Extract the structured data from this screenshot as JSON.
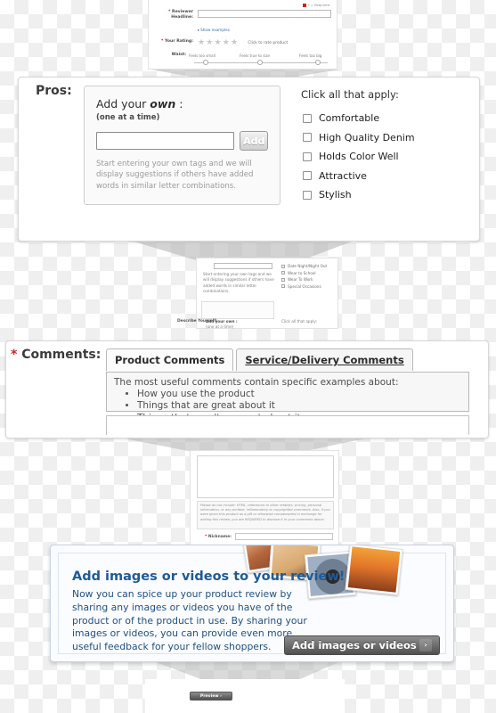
{
  "background": {
    "pattern": "transparency-checkerboard",
    "light": "#ffffff",
    "dark": "#efefef"
  },
  "top_form": {
    "required_note": "* = Required",
    "rows": [
      {
        "label": "Reviewer Headline:",
        "required": true,
        "link": "Show examples",
        "input_value": ""
      },
      {
        "label": "Your Rating:",
        "required": true,
        "stars": "★★★★★",
        "hint": "Click to rate product"
      },
      {
        "label": "Waist:",
        "required": false,
        "slider_captions": [
          "Feels too small",
          "Feels true to size",
          "Feels too big"
        ]
      }
    ]
  },
  "pros_section": {
    "label": "Pros:",
    "own_title_prefix": "Add your ",
    "own_title_emphasis": "own",
    "own_title_suffix": " :",
    "own_subtitle": "(one at a time)",
    "input_value": "",
    "add_button": "Add",
    "hint": "Start entering your own tags and we will display suggestions if others have added words in similar letter combinations.",
    "apply_heading": "Click all that apply:",
    "checkboxes": [
      {
        "label": "Comfortable",
        "checked": false
      },
      {
        "label": "High Quality Denim",
        "checked": false
      },
      {
        "label": "Holds Color Well",
        "checked": false
      },
      {
        "label": "Attractive",
        "checked": false
      },
      {
        "label": "Stylish",
        "checked": false
      }
    ]
  },
  "mid_mini_form": {
    "hint": "Start entering your own tags and we will display suggestions if others have added words in similar letter combinations.",
    "apply_heading": "Click all that apply:",
    "checkboxes": [
      "Date Night/Night Out",
      "Wear to School",
      "Wear To Work",
      "Special Occasions"
    ],
    "describe_label": "Describe Yourself:",
    "own_title": "Add your own :",
    "own_sub": "(one at a time)",
    "apply_heading2": "Click all that apply:"
  },
  "comments_section": {
    "label": "Comments:",
    "required": true,
    "tabs": [
      {
        "label": "Product Comments",
        "active": true
      },
      {
        "label": "Service/Delivery Comments",
        "active": false
      }
    ],
    "panel_heading": "The most useful comments contain specific examples about:",
    "bullets": [
      "How you use the product",
      "Things that are great about it",
      "Things that aren't so great about it"
    ]
  },
  "bottom_mini_form": {
    "textarea_value": "",
    "disclaimer": "Please do not include: HTML, references to other retailers, pricing, personal information, or any profane, inflammatory or copyrighted comments. Also, if you were given this product as a gift or otherwise compensated in exchange for writing this review, you are REQUIRED to disclose it in your comments above.",
    "nickname_label": "Nickname:",
    "nickname_required": true,
    "nickname_value": ""
  },
  "media_callout": {
    "title": "Add images or videos to your review!",
    "body": "Now you can spice up your product review by sharing any images or videos you have of the product or of the product in use. By sharing your images or videos, you can provide even more useful feedback for your fellow shoppers.",
    "button_label": "Add images or videos",
    "button_chevron": "›",
    "accent_color": "#1f5a96",
    "panel_background": "#fbfcff",
    "photos": [
      "canyon-photo",
      "sunglasses-photo",
      "watch-photo",
      "sailboat-sunset-photo"
    ]
  },
  "preview_bar": {
    "button_label": "Preview ›"
  }
}
